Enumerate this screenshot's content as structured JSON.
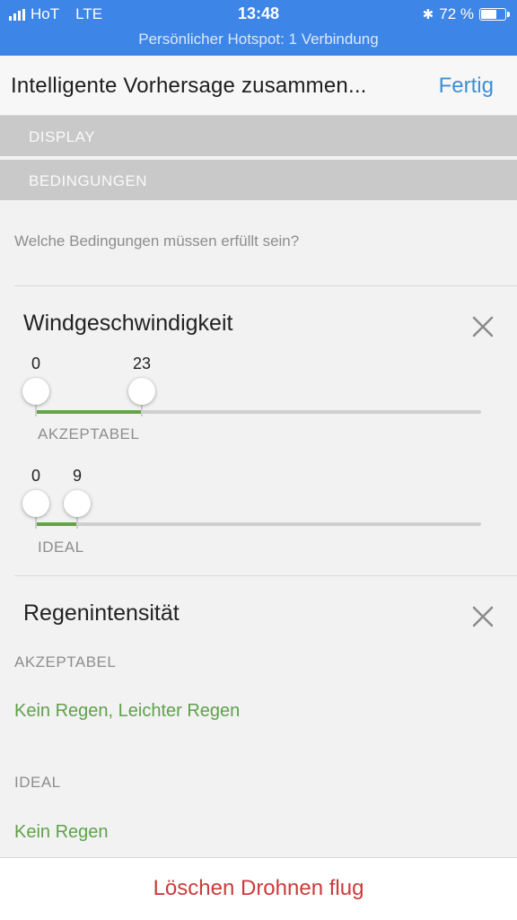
{
  "status_bar": {
    "carrier": "HoT",
    "network": "LTE",
    "time": "13:48",
    "battery_text": "72 %",
    "battery_level": 0.72,
    "hotspot": "Persönlicher Hotspot: 1 Verbindung"
  },
  "nav": {
    "title": "Intelligente Vorhersage zusammen...",
    "done": "Fertig"
  },
  "sections": {
    "display": "DISPLAY",
    "conditions": "BEDINGUNGEN"
  },
  "question": "Welche Bedingungen müssen erfüllt sein?",
  "wind": {
    "title": "Windgeschwindigkeit",
    "acceptable": {
      "min": "0",
      "max": "23",
      "label": "AKZEPTABEL"
    },
    "ideal": {
      "min": "0",
      "max": "9",
      "label": "IDEAL"
    }
  },
  "rain": {
    "title": "Regenintensität",
    "acceptable_label": "AKZEPTABEL",
    "acceptable_value": "Kein Regen, Leichter Regen",
    "ideal_label": "IDEAL",
    "ideal_value": "Kein Regen"
  },
  "delete_button": "Löschen Drohnen flug",
  "colors": {
    "status_bar": "#3d85e6",
    "link": "#3d8fd6",
    "accent_green": "#64a346",
    "destructive": "#cc3b3b"
  }
}
